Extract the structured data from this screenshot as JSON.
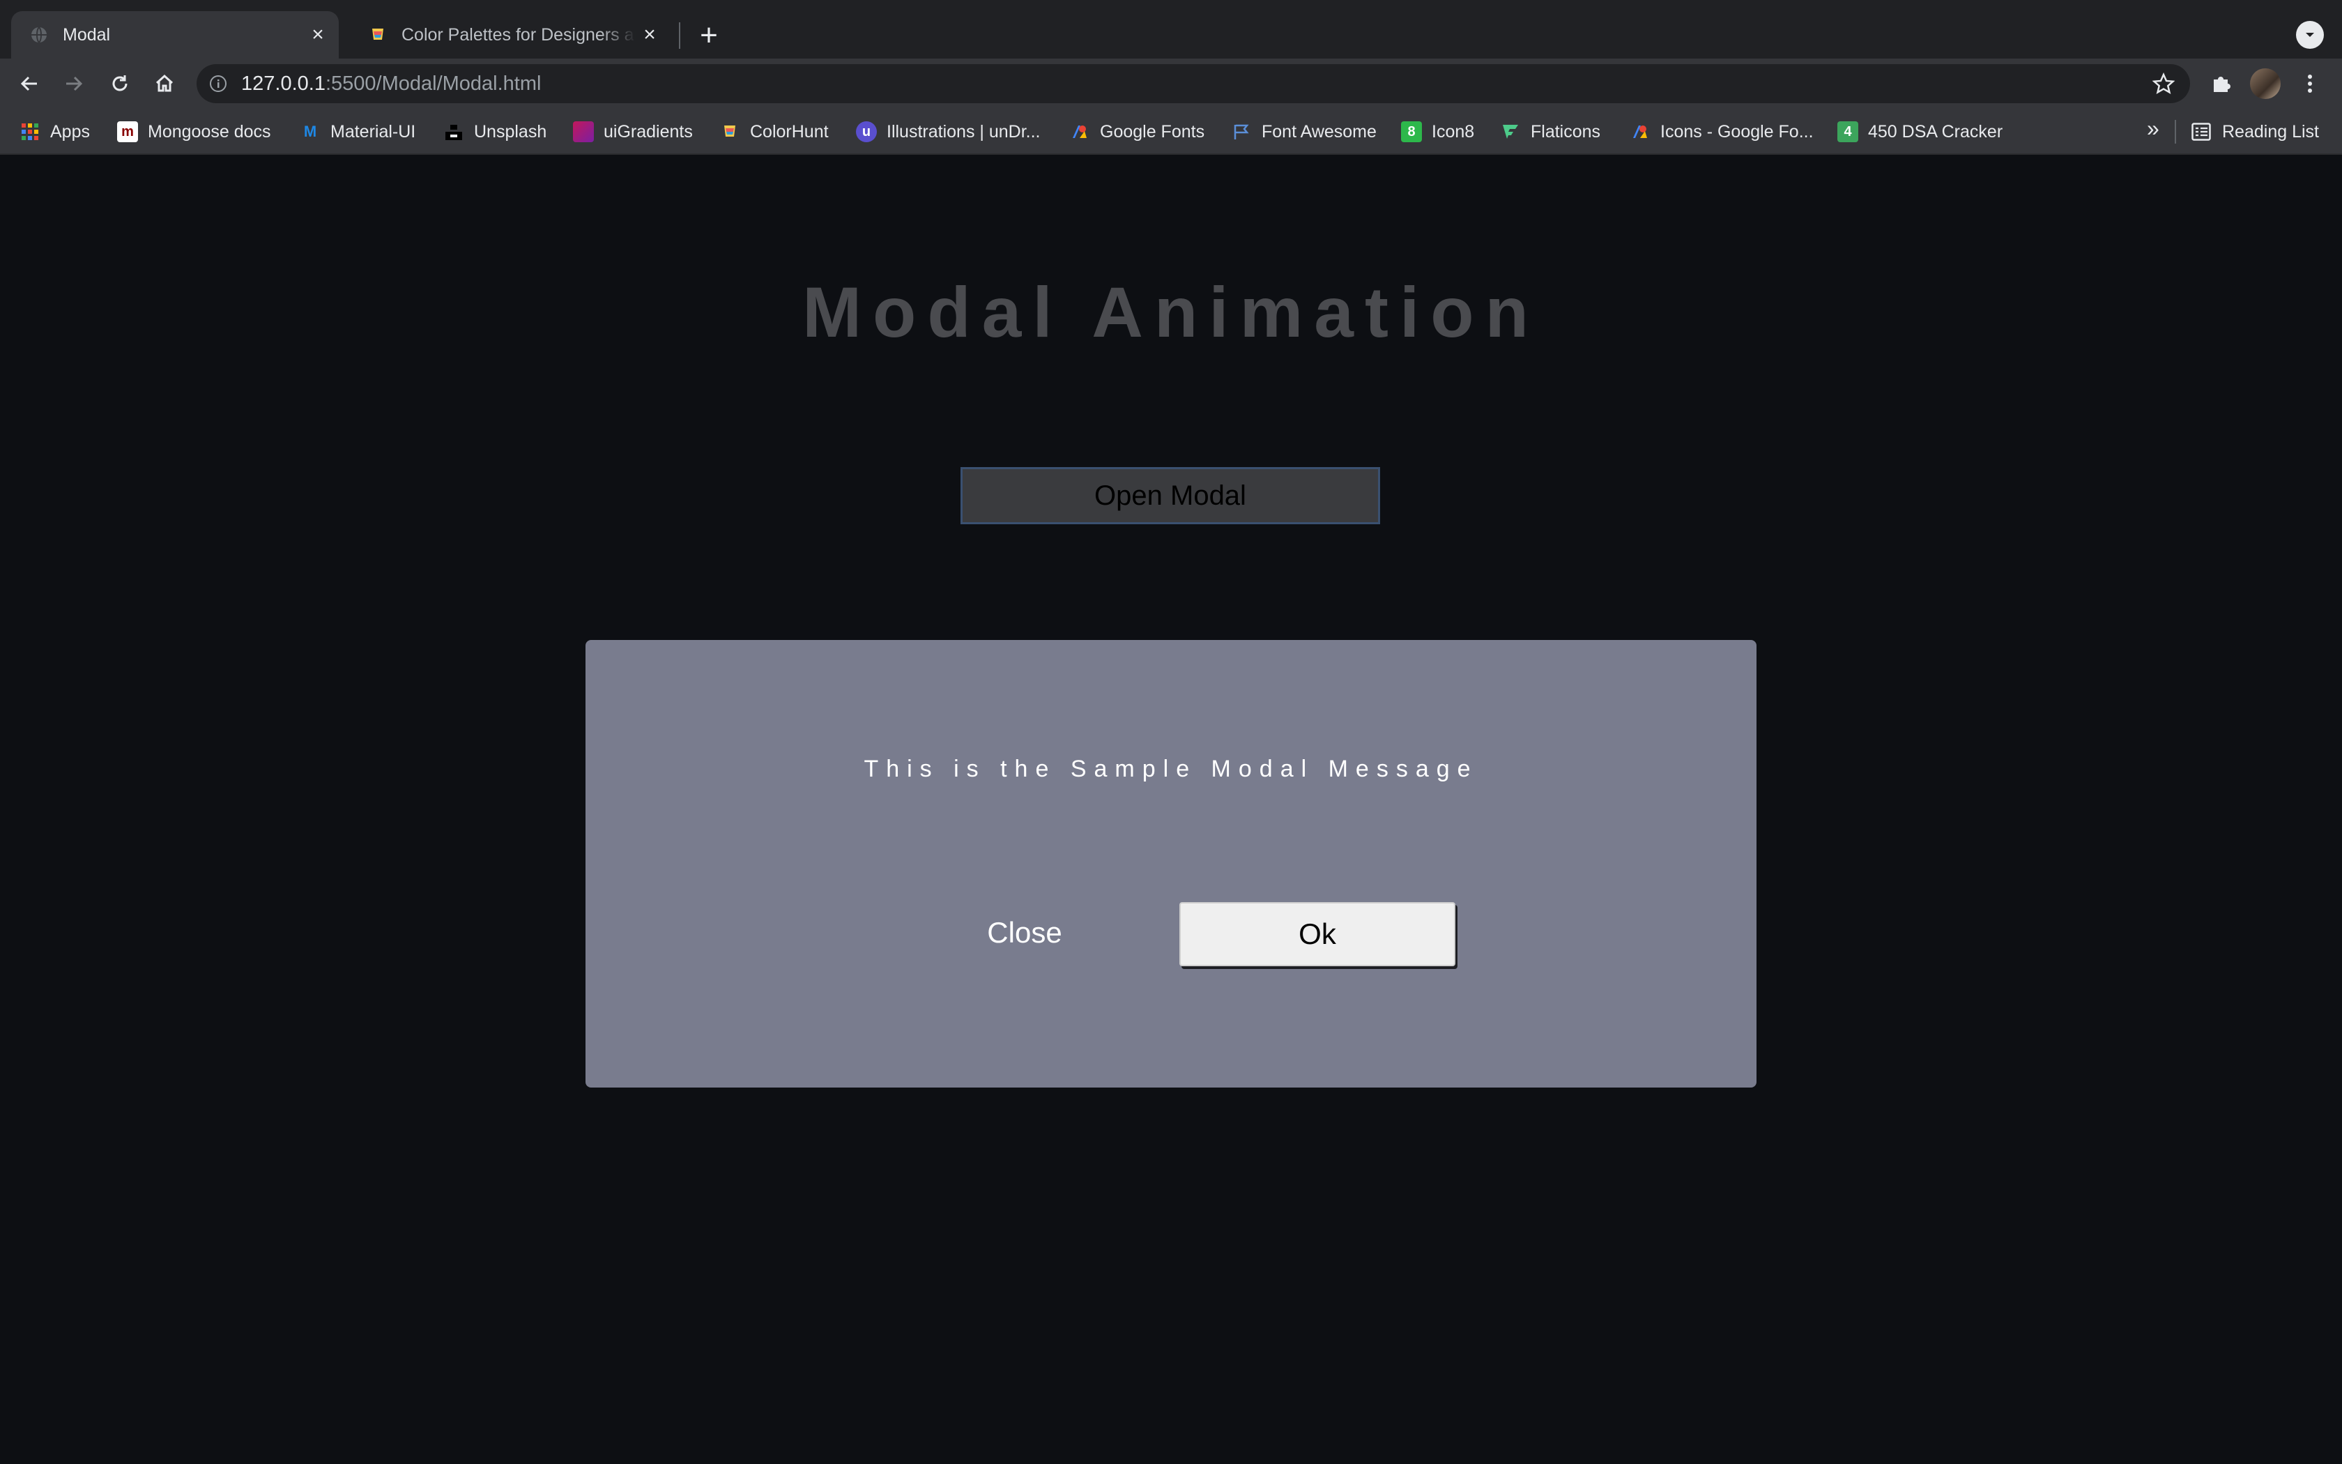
{
  "browser": {
    "tabs": [
      {
        "title": "Modal",
        "active": true
      },
      {
        "title": "Color Palettes for Designers and Artists - Color Hunt",
        "active": false
      }
    ],
    "new_tab_symbol": "+",
    "address": {
      "host": "127.0.0.1",
      "rest": ":5500/Modal/Modal.html"
    },
    "bookmarks": [
      {
        "label": "Apps",
        "icon": "apps-grid-icon"
      },
      {
        "label": "Mongoose docs",
        "icon": "mongoose-icon"
      },
      {
        "label": "Material-UI",
        "icon": "material-ui-icon"
      },
      {
        "label": "Unsplash",
        "icon": "unsplash-icon"
      },
      {
        "label": "uiGradients",
        "icon": "uigradients-icon"
      },
      {
        "label": "ColorHunt",
        "icon": "colorhunt-icon"
      },
      {
        "label": "Illustrations | unDr...",
        "icon": "undraw-icon"
      },
      {
        "label": "Google Fonts",
        "icon": "google-fonts-icon"
      },
      {
        "label": "Font Awesome",
        "icon": "font-awesome-icon"
      },
      {
        "label": "Icon8",
        "icon": "icon8-icon"
      },
      {
        "label": "Flaticons",
        "icon": "flaticon-icon"
      },
      {
        "label": "Icons - Google Fo...",
        "icon": "google-icons-icon"
      },
      {
        "label": "450 DSA Cracker",
        "icon": "dsa-cracker-icon"
      }
    ],
    "bookmarks_overflow": "»",
    "reading_list": "Reading List"
  },
  "page": {
    "heading": "Modal Animation",
    "open_button": "Open Modal",
    "modal": {
      "message": "This is the Sample Modal Message",
      "close_label": "Close",
      "ok_label": "Ok"
    }
  },
  "colors": {
    "page_background": "#0d0f13",
    "modal_background": "#797c8e",
    "heading": "#4a4b4f"
  }
}
